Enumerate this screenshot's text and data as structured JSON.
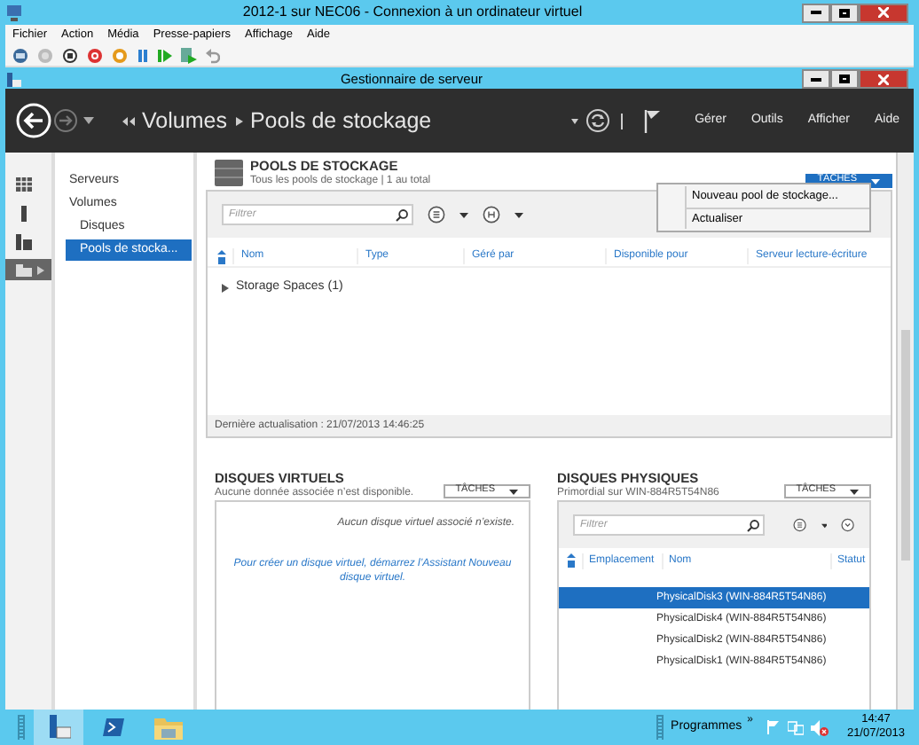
{
  "window": {
    "title": "2012-1 sur NEC06 - Connexion à un ordinateur virtuel"
  },
  "menu": [
    "Fichier",
    "Action",
    "Média",
    "Presse-papiers",
    "Affichage",
    "Aide"
  ],
  "app": {
    "title": "Gestionnaire de serveur"
  },
  "nav": {
    "breadcrumb": [
      "Volumes",
      "Pools de stockage"
    ],
    "menu": [
      "Gérer",
      "Outils",
      "Afficher",
      "Aide"
    ]
  },
  "sidebar_icons": [
    {
      "kind": "dashboard",
      "selected": false
    },
    {
      "kind": "server",
      "selected": false
    },
    {
      "kind": "servers",
      "selected": false
    },
    {
      "kind": "storage",
      "selected": true
    }
  ],
  "sidebar": {
    "items": [
      {
        "label": "Serveurs",
        "selected": false
      },
      {
        "label": "Volumes",
        "selected": false,
        "children": [
          {
            "label": "Disques",
            "selected": false
          },
          {
            "label": "Pools de stocka...",
            "selected": true
          }
        ]
      }
    ]
  },
  "pools": {
    "title": "POOLS DE STOCKAGE",
    "subtitle": "Tous les pools de stockage | 1 au total",
    "tasks_button": "TÂCHES",
    "filter_placeholder": "Filtrer",
    "columns": [
      "Nom",
      "Type",
      "Géré par",
      "Disponible pour",
      "Serveur lecture-écriture"
    ],
    "groups": [
      {
        "label": "Storage Spaces (1)",
        "expanded": false
      }
    ],
    "footer": "Dernière actualisation : 21/07/2013 14:46:25"
  },
  "tasks_menu": [
    "Nouveau pool de stockage...",
    "Actualiser"
  ],
  "virtual_disks": {
    "title": "DISQUES VIRTUELS",
    "subtitle": "Aucune donnée associée n’est disponible.",
    "tasks_button": "TÂCHES",
    "empty_message": "Aucun disque virtuel associé n’existe.",
    "hint": "Pour créer un disque virtuel, démarrez l’Assistant Nouveau disque virtuel."
  },
  "physical_disks": {
    "title": "DISQUES PHYSIQUES",
    "subtitle": "Primordial sur WIN-884R5T54N86",
    "tasks_button": "TÂCHES",
    "filter_placeholder": "Filtrer",
    "columns": [
      "Emplacement",
      "Nom",
      "Statut"
    ],
    "rows": [
      {
        "name": "PhysicalDisk3 (WIN-884R5T54N86)",
        "selected": true
      },
      {
        "name": "PhysicalDisk4 (WIN-884R5T54N86)",
        "selected": false
      },
      {
        "name": "PhysicalDisk2 (WIN-884R5T54N86)",
        "selected": false
      },
      {
        "name": "PhysicalDisk1 (WIN-884R5T54N86)",
        "selected": false
      }
    ]
  },
  "taskbar": {
    "programs": "Programmes",
    "overflow": "»",
    "time": "14:47",
    "date": "21/07/2013"
  }
}
